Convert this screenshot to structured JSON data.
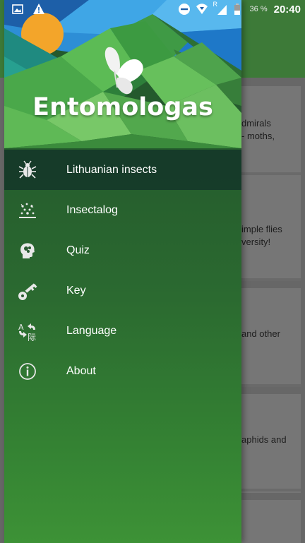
{
  "status_bar": {
    "battery_percent": "36 %",
    "time": "20:40",
    "roaming_indicator": "R",
    "icons": [
      "image-icon",
      "warning-icon",
      "dnd-icon",
      "wifi-icon",
      "signal-icon",
      "battery-icon"
    ]
  },
  "drawer": {
    "app_title": "Entomologas",
    "menu_items": [
      {
        "label": "Lithuanian insects",
        "icon": "bug-icon",
        "active": true
      },
      {
        "label": "Insectalog",
        "icon": "insectalog-icon",
        "active": false
      },
      {
        "label": "Quiz",
        "icon": "quiz-head-icon",
        "active": false
      },
      {
        "label": "Key",
        "icon": "key-icon",
        "active": false
      },
      {
        "label": "Language",
        "icon": "translate-icon",
        "active": false
      },
      {
        "label": "About",
        "icon": "info-icon",
        "active": false
      }
    ]
  },
  "background_cards": [
    {
      "text_line1": "dmirals",
      "text_line2": "- moths,"
    },
    {
      "text_line1": "imple flies",
      "text_line2": "versity!"
    },
    {
      "text_line1": "and other",
      "text_line2": ""
    },
    {
      "text_line1": "aphids and",
      "text_line2": ""
    }
  ],
  "colors": {
    "toolbar": "#3d7a38",
    "drawer_top": "#1e4e2c",
    "drawer_bottom": "#3d9236",
    "active_item": "#123028",
    "scrim": "#676767"
  }
}
